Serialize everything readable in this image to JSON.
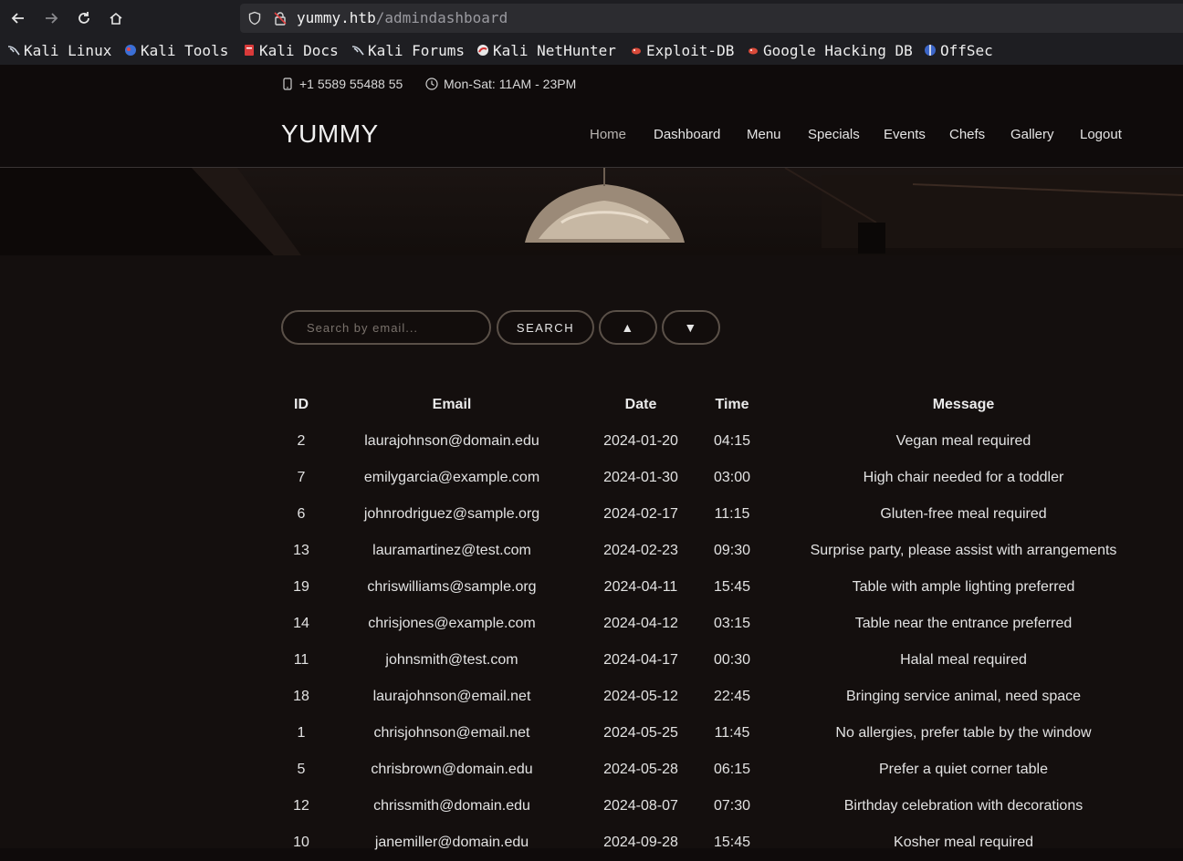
{
  "browser": {
    "url_host": "yummy.htb",
    "url_path": "/admindashboard",
    "bookmarks": [
      "Kali Linux",
      "Kali Tools",
      "Kali Docs",
      "Kali Forums",
      "Kali NetHunter",
      "Exploit-DB",
      "Google Hacking DB",
      "OffSec"
    ]
  },
  "topbar": {
    "phone": "+1 5589 55488 55",
    "hours": "Mon-Sat: 11AM - 23PM"
  },
  "header": {
    "logo": "YUMMY",
    "nav": [
      "Home",
      "Dashboard",
      "Menu",
      "Specials",
      "Events",
      "Chefs",
      "Gallery",
      "Logout"
    ]
  },
  "controls": {
    "search_placeholder": "Search by email...",
    "search_label": "SEARCH",
    "sort_asc": "▲",
    "sort_desc": "▼"
  },
  "table": {
    "headers": [
      "ID",
      "Email",
      "Date",
      "Time",
      "Message"
    ],
    "rows": [
      [
        "2",
        "laurajohnson@domain.edu",
        "2024-01-20",
        "04:15",
        "Vegan meal required"
      ],
      [
        "7",
        "emilygarcia@example.com",
        "2024-01-30",
        "03:00",
        "High chair needed for a toddler"
      ],
      [
        "6",
        "johnrodriguez@sample.org",
        "2024-02-17",
        "11:15",
        "Gluten-free meal required"
      ],
      [
        "13",
        "lauramartinez@test.com",
        "2024-02-23",
        "09:30",
        "Surprise party, please assist with arrangements"
      ],
      [
        "19",
        "chriswilliams@sample.org",
        "2024-04-11",
        "15:45",
        "Table with ample lighting preferred"
      ],
      [
        "14",
        "chrisjones@example.com",
        "2024-04-12",
        "03:15",
        "Table near the entrance preferred"
      ],
      [
        "11",
        "johnsmith@test.com",
        "2024-04-17",
        "00:30",
        "Halal meal required"
      ],
      [
        "18",
        "laurajohnson@email.net",
        "2024-05-12",
        "22:45",
        "Bringing service animal, need space"
      ],
      [
        "1",
        "chrisjohnson@email.net",
        "2024-05-25",
        "11:45",
        "No allergies, prefer table by the window"
      ],
      [
        "5",
        "chrisbrown@domain.edu",
        "2024-05-28",
        "06:15",
        "Prefer a quiet corner table"
      ],
      [
        "12",
        "chrissmith@domain.edu",
        "2024-08-07",
        "07:30",
        "Birthday celebration with decorations"
      ],
      [
        "10",
        "janemiller@domain.edu",
        "2024-09-28",
        "15:45",
        "Kosher meal required"
      ]
    ]
  }
}
